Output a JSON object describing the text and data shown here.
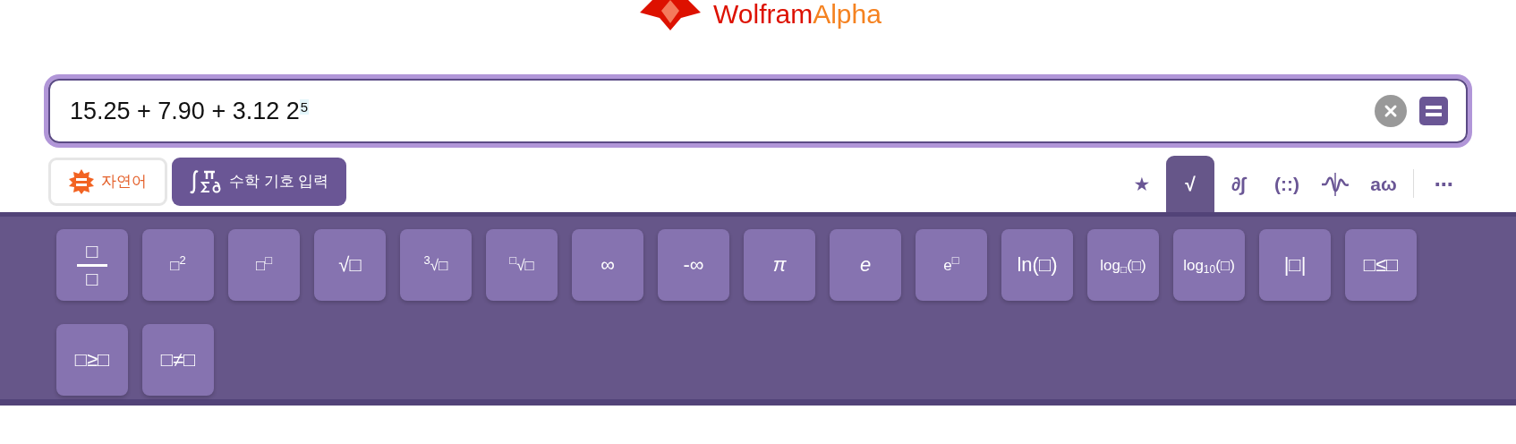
{
  "logo": {
    "part1": "Wolfram",
    "part2": "Alpha"
  },
  "input": {
    "value": "15.25 + 7.90 + 3.12 2$^{5}$"
  },
  "input_modes": [
    {
      "kind": "natural",
      "label": "자연어",
      "selected": false
    },
    {
      "kind": "math",
      "label": "수학 기호 입력",
      "selected": true
    }
  ],
  "keyboard_tabs": [
    {
      "kind": "text",
      "label": "★",
      "selected": false
    },
    {
      "kind": "text",
      "label": "√",
      "selected": true
    },
    {
      "kind": "text",
      "label": "∂∫",
      "selected": false
    },
    {
      "kind": "text",
      "label": "(::)",
      "selected": false
    },
    {
      "kind": "wave",
      "selected": false
    },
    {
      "kind": "text",
      "label": "aω",
      "selected": false
    },
    {
      "kind": "text",
      "label": "⋯",
      "selected": false
    }
  ],
  "keys": [
    {
      "kind": "fraction",
      "numerator": "□",
      "denominator": "□"
    },
    {
      "kind": "text",
      "label": "□$^{2}$"
    },
    {
      "kind": "text",
      "label": "□$^{□}$"
    },
    {
      "kind": "text",
      "label": "√□"
    },
    {
      "kind": "text",
      "label": "$^{3}$√□"
    },
    {
      "kind": "text",
      "label": "$^{□}$√□"
    },
    {
      "kind": "text",
      "label": "∞"
    },
    {
      "kind": "text",
      "label": "-∞"
    },
    {
      "kind": "italic",
      "label": "π"
    },
    {
      "kind": "italic",
      "label": "e"
    },
    {
      "kind": "text",
      "label": "e$^{□}$"
    },
    {
      "kind": "text",
      "label": "ln(□)"
    },
    {
      "kind": "text",
      "label": "log$_{□}$(□)"
    },
    {
      "kind": "text",
      "label": "log$_{10}$(□)"
    },
    {
      "kind": "text",
      "label": "|□|"
    },
    {
      "kind": "text",
      "label": "□≤□"
    },
    {
      "kind": "text",
      "label": "□≥□"
    },
    {
      "kind": "text",
      "label": "□≠□"
    }
  ]
}
